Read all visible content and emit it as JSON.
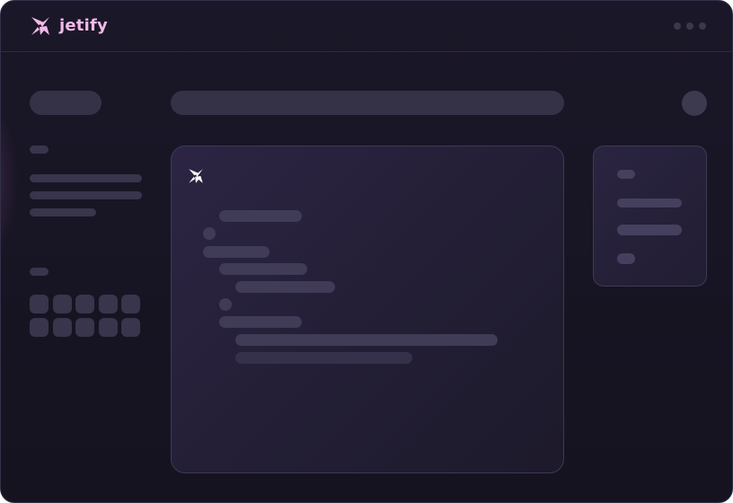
{
  "app": {
    "brand_name": "jetify",
    "brand_color": "#f2b9e8",
    "logo_icon": "jetify-star-logo"
  },
  "window_controls": [
    "dot",
    "dot",
    "dot"
  ],
  "sidebar": {
    "tiles": 10
  },
  "colors": {
    "background": "#17141f",
    "skeleton": "#38354c",
    "card_border": "#3e3a55"
  }
}
